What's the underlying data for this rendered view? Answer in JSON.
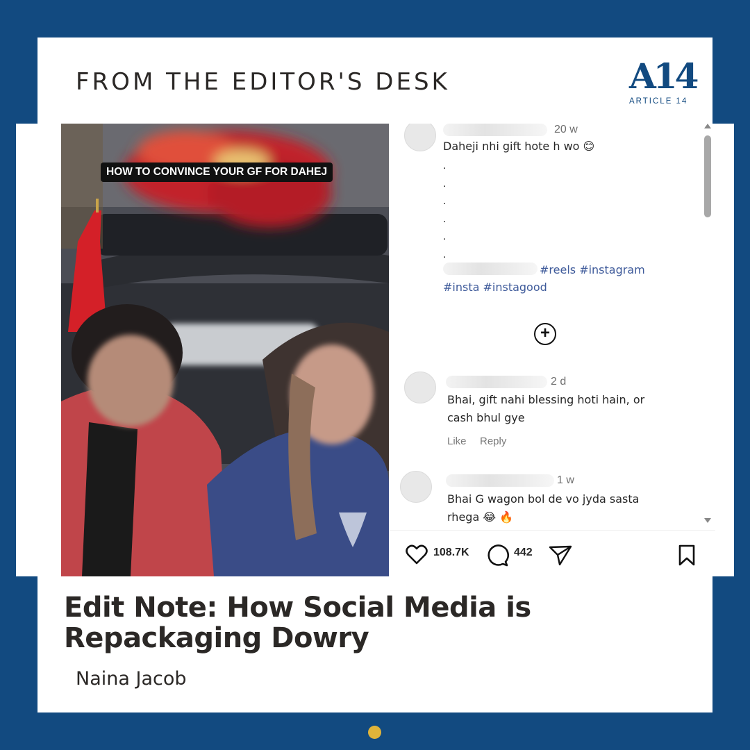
{
  "header": {
    "title": "FROM THE EDITOR'S DESK",
    "logo_mark": "A14",
    "logo_text": "ARTICLE 14"
  },
  "post": {
    "caption_overlay": "HOW TO CONVINCE YOUR GF FOR DAHEJ",
    "caption_comment": {
      "time": "20 w",
      "text": "Daheji nhi gift hote h wo 😊",
      "dots": [
        ".",
        ".",
        ".",
        ".",
        ".",
        "."
      ],
      "hashtags_line1": "#reels #instagram",
      "hashtags_line2": "#insta #instagood"
    },
    "comments": [
      {
        "time": "2 d",
        "text": "Bhai, gift nahi blessing hoti hain, or cash bhul gye",
        "like_label": "Like",
        "reply_label": "Reply"
      },
      {
        "time": "1 w",
        "text": "Bhai G wagon bol de vo jyda sasta rhega 😂 🔥"
      }
    ],
    "likes": "108.7K",
    "comment_count": "442",
    "icons": {
      "like": "heart-icon",
      "comment": "comment-icon",
      "share": "send-icon",
      "save": "bookmark-icon",
      "more": "plus-circle-icon"
    }
  },
  "article": {
    "title": "Edit Note: How Social Media is Repackaging Dowry",
    "author": "Naina Jacob"
  },
  "colors": {
    "brand_blue": "#124a80",
    "accent_gold": "#e0b43a",
    "hashtag": "#3e5a9a"
  }
}
